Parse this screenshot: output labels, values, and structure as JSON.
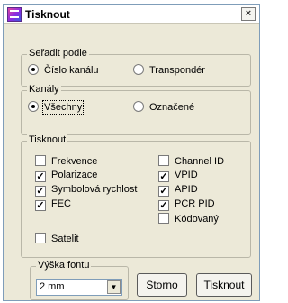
{
  "window": {
    "title": "Tisknout",
    "close_glyph": "×"
  },
  "sort_group": {
    "title": "Seřadit podle",
    "options": [
      {
        "label": "Číslo kanálu",
        "selected": true
      },
      {
        "label": "Transpondér",
        "selected": false
      }
    ]
  },
  "channels_group": {
    "title": "Kanály",
    "options": [
      {
        "label": "Všechny",
        "selected": true
      },
      {
        "label": "Označené",
        "selected": false
      }
    ]
  },
  "print_group": {
    "title": "Tisknout",
    "left": [
      {
        "label": "Frekvence",
        "checked": false
      },
      {
        "label": "Polarizace",
        "checked": true
      },
      {
        "label": "Symbolová rychlost",
        "checked": true
      },
      {
        "label": "FEC",
        "checked": true
      },
      {
        "label": "Satelit",
        "checked": false
      }
    ],
    "right": [
      {
        "label": "Channel ID",
        "checked": false
      },
      {
        "label": "VPID",
        "checked": true
      },
      {
        "label": "APID",
        "checked": true
      },
      {
        "label": "PCR PID",
        "checked": true
      },
      {
        "label": "Kódovaný",
        "checked": false
      }
    ]
  },
  "font_group": {
    "title": "Výška fontu",
    "value": "2 mm"
  },
  "buttons": {
    "cancel": "Storno",
    "print": "Tisknout"
  },
  "glyphs": {
    "check": "✓",
    "dropdown": "▼"
  }
}
